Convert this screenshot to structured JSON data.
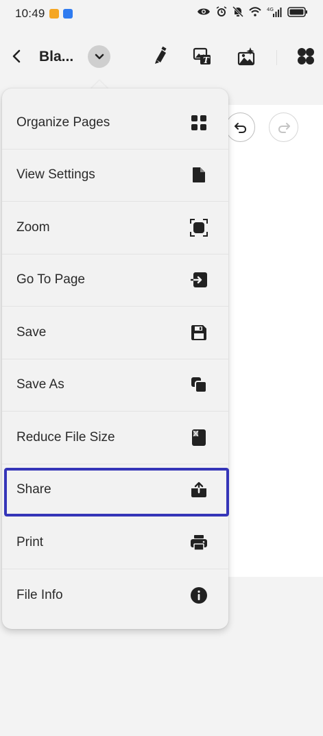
{
  "status_bar": {
    "time": "10:49",
    "icons": [
      "eye-icon",
      "alarm-icon",
      "mute-icon",
      "wifi-icon",
      "signal-icon",
      "battery-icon"
    ],
    "network_label": "4G"
  },
  "toolbar": {
    "title": "Bla...",
    "tools": [
      "highlighter-icon",
      "image-text-icon",
      "image-edit-icon",
      "apps-icon"
    ]
  },
  "menu": {
    "items": [
      {
        "label": "Organize Pages",
        "icon": "grid-icon"
      },
      {
        "label": "View Settings",
        "icon": "document-icon"
      },
      {
        "label": "Zoom",
        "icon": "zoom-frame-icon"
      },
      {
        "label": "Go To Page",
        "icon": "go-to-page-icon"
      },
      {
        "label": "Save",
        "icon": "floppy-disk-icon"
      },
      {
        "label": "Save As",
        "icon": "copy-icon"
      },
      {
        "label": "Reduce File Size",
        "icon": "compress-file-icon"
      },
      {
        "label": "Share",
        "icon": "share-upload-icon"
      },
      {
        "label": "Print",
        "icon": "printer-icon"
      },
      {
        "label": "File Info",
        "icon": "info-icon"
      }
    ],
    "highlighted": "Share"
  },
  "colors": {
    "highlight": "#3535b8",
    "background": "#f3f3f3",
    "menu_background": "#f2f2f2"
  }
}
